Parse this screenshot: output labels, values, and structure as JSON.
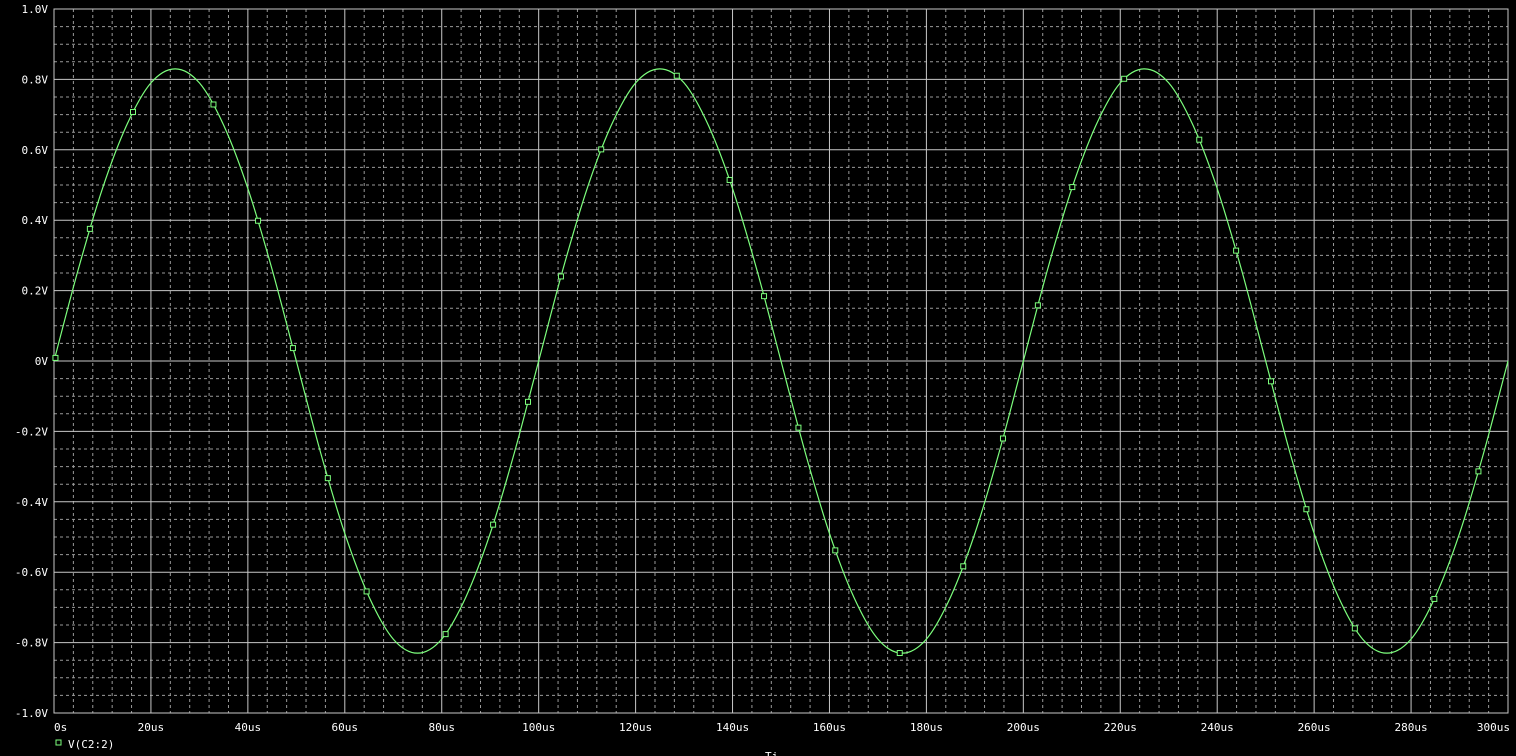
{
  "colors": {
    "background": "#000000",
    "grid_major": "#c8c8c8",
    "grid_minor": "#9a9a9a",
    "trace": "#7dff7d",
    "text": "#ffffff"
  },
  "legend": {
    "marker_icon": "square-marker-icon",
    "label": "V(C2:2)",
    "placement": "bottom-left"
  },
  "chart_data": {
    "type": "line",
    "title": "",
    "xlabel": "Ti",
    "ylabel": "",
    "xlim": [
      0,
      300
    ],
    "ylim": [
      -1.0,
      1.0
    ],
    "grid": true,
    "x_unit": "us",
    "x_tick_values": [
      0,
      20,
      40,
      60,
      80,
      100,
      120,
      140,
      160,
      180,
      200,
      220,
      240,
      260,
      280,
      300
    ],
    "x_tick_labels": [
      "0s",
      "20us",
      "40us",
      "60us",
      "80us",
      "100us",
      "120us",
      "140us",
      "160us",
      "180us",
      "200us",
      "220us",
      "240us",
      "260us",
      "280us",
      "300us"
    ],
    "y_tick_values": [
      1.0,
      0.8,
      0.6,
      0.4,
      0.2,
      0.0,
      -0.2,
      -0.4,
      -0.6,
      -0.8,
      -1.0
    ],
    "y_tick_labels": [
      "1.0V",
      "0.8V",
      "0.6V",
      "0.4V",
      "0.2V",
      "0V",
      "-0.2V",
      "-0.4V",
      "-0.6V",
      "-0.8V",
      "-1.0V"
    ],
    "series": [
      {
        "name": "V(C2:2)",
        "color": "#7dff7d",
        "x": [
          0,
          5,
          10,
          15,
          20,
          25,
          30,
          35,
          40,
          45,
          50,
          55,
          60,
          65,
          70,
          75,
          80,
          85,
          90,
          95,
          100,
          105,
          110,
          115,
          120,
          125,
          130,
          135,
          140,
          145,
          150,
          155,
          160,
          165,
          170,
          175,
          180,
          185,
          190,
          195,
          200,
          205,
          210,
          215,
          220,
          225,
          230,
          235,
          240,
          245,
          250,
          255,
          260,
          265,
          270,
          275,
          280,
          285,
          290,
          295,
          300
        ],
        "y": [
          0.0,
          0.26,
          0.49,
          0.67,
          0.79,
          0.83,
          0.79,
          0.67,
          0.49,
          0.26,
          0.0,
          -0.26,
          -0.49,
          -0.67,
          -0.79,
          -0.83,
          -0.79,
          -0.67,
          -0.49,
          -0.26,
          0.0,
          0.26,
          0.49,
          0.67,
          0.79,
          0.83,
          0.79,
          0.67,
          0.49,
          0.26,
          0.0,
          -0.26,
          -0.49,
          -0.67,
          -0.79,
          -0.83,
          -0.79,
          -0.67,
          -0.49,
          -0.26,
          0.0,
          0.26,
          0.49,
          0.67,
          0.79,
          0.83,
          0.79,
          0.67,
          0.49,
          0.26,
          0.0,
          -0.26,
          -0.49,
          -0.67,
          -0.79,
          -0.83,
          -0.79,
          -0.67,
          -0.49,
          -0.26,
          0.0
        ]
      }
    ],
    "markers_x": [
      0.3,
      7.4,
      16.3,
      32.9,
      42.1,
      49.3,
      56.5,
      64.5,
      80.8,
      90.6,
      97.8,
      104.6,
      112.9,
      128.5,
      139.4,
      146.5,
      153.6,
      161.2,
      174.5,
      187.6,
      195.8,
      203.0,
      210.1,
      220.8,
      236.3,
      243.9,
      251.1,
      258.4,
      268.4,
      284.8,
      293.9
    ]
  }
}
